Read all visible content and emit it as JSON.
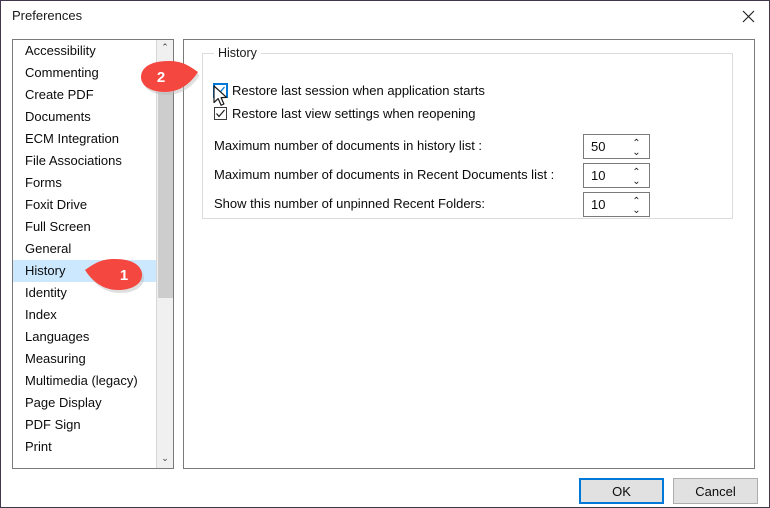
{
  "window": {
    "title": "Preferences",
    "close_icon": "close-icon"
  },
  "sidebar": {
    "items": [
      {
        "label": "Accessibility",
        "selected": false
      },
      {
        "label": "Commenting",
        "selected": false
      },
      {
        "label": "Create PDF",
        "selected": false
      },
      {
        "label": "Documents",
        "selected": false
      },
      {
        "label": "ECM Integration",
        "selected": false
      },
      {
        "label": "File Associations",
        "selected": false
      },
      {
        "label": "Forms",
        "selected": false
      },
      {
        "label": "Foxit Drive",
        "selected": false
      },
      {
        "label": "Full Screen",
        "selected": false
      },
      {
        "label": "General",
        "selected": false
      },
      {
        "label": "History",
        "selected": true
      },
      {
        "label": "Identity",
        "selected": false
      },
      {
        "label": "Index",
        "selected": false
      },
      {
        "label": "Languages",
        "selected": false
      },
      {
        "label": "Measuring",
        "selected": false
      },
      {
        "label": "Multimedia (legacy)",
        "selected": false
      },
      {
        "label": "Page Display",
        "selected": false
      },
      {
        "label": "PDF Sign",
        "selected": false
      },
      {
        "label": "Print",
        "selected": false
      }
    ],
    "scroll_up_glyph": "⌃",
    "scroll_down_glyph": "⌄"
  },
  "history_panel": {
    "group_title": "History",
    "checkboxes": [
      {
        "label": "Restore last session when application starts",
        "checked": true,
        "focused": true
      },
      {
        "label": "Restore last view settings when reopening",
        "checked": true,
        "focused": false
      }
    ],
    "fields": [
      {
        "label": "Maximum number of documents in history list :",
        "value": "50"
      },
      {
        "label": "Maximum number of documents in Recent Documents list :",
        "value": "10"
      },
      {
        "label": "Show this number of unpinned Recent Folders:",
        "value": "10"
      }
    ],
    "spin_up_glyph": "⌃",
    "spin_down_glyph": "⌄"
  },
  "footer": {
    "ok_label": "OK",
    "cancel_label": "Cancel"
  },
  "annotations": {
    "badges": [
      {
        "number": "1",
        "direction": "left"
      },
      {
        "number": "2",
        "direction": "right"
      }
    ],
    "color": "#f4473f"
  }
}
